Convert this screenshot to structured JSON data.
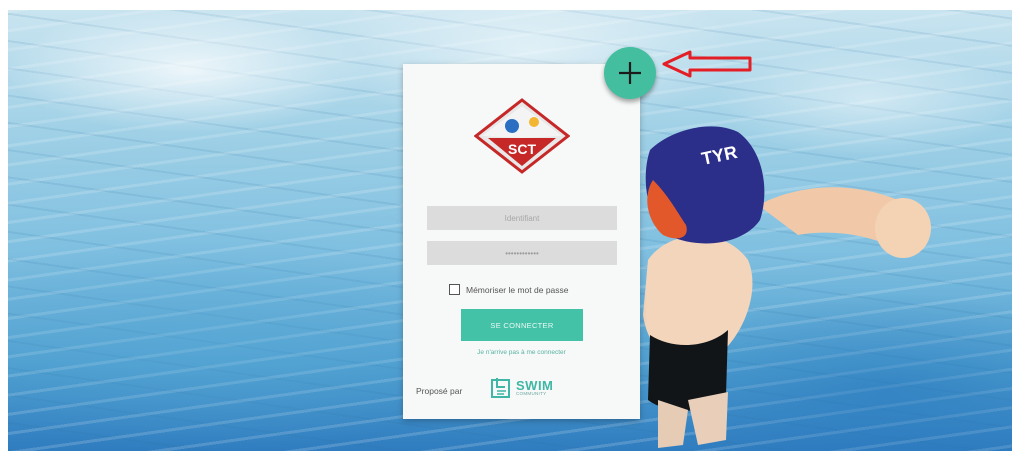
{
  "login_card": {
    "username_placeholder": "Identifiant",
    "password_value": "••••••••••••",
    "remember_label": "Mémoriser le mot de passe",
    "submit_label": "SE CONNECTER",
    "help_link": "Je n'arrive pas à me connecter",
    "powered_by": "Proposé par",
    "brand_name": "SWIM",
    "brand_sub": "COMMUNITY",
    "club_logo_text": "SCT"
  },
  "overlay": {
    "fab_icon": "plus-icon",
    "annotation": "red-arrow-icon"
  },
  "colors": {
    "accent": "#44c2a8",
    "annotation": "#e31e24"
  }
}
